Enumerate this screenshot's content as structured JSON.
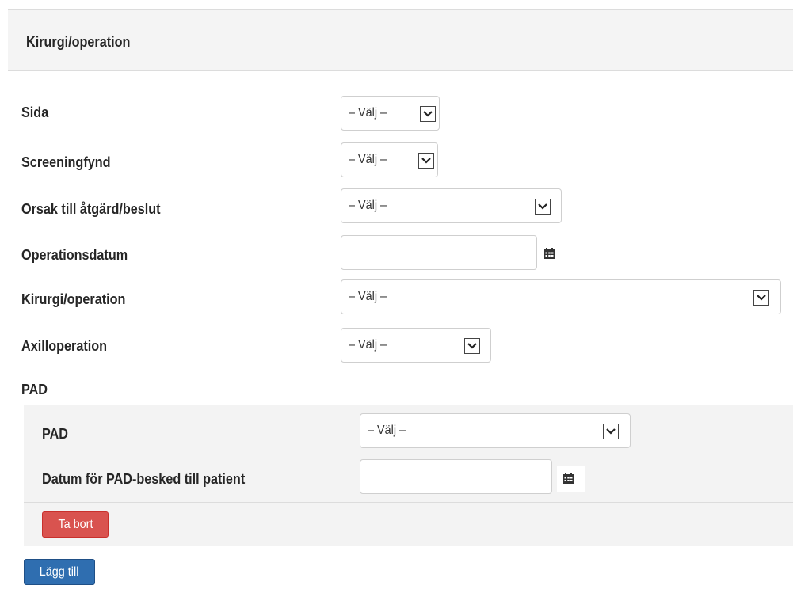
{
  "panel": {
    "title": "Kirurgi/operation"
  },
  "fields": {
    "sida": {
      "label": "Sida",
      "value": "– Välj –"
    },
    "screeningfynd": {
      "label": "Screeningfynd",
      "value": "– Välj –"
    },
    "orsak": {
      "label": "Orsak till åtgärd/beslut",
      "value": "– Välj –"
    },
    "operationsdatum": {
      "label": "Operationsdatum",
      "value": ""
    },
    "kirurgi": {
      "label": "Kirurgi/operation",
      "value": "– Välj –"
    },
    "axilloperation": {
      "label": "Axilloperation",
      "value": "– Välj –"
    }
  },
  "pad_section": {
    "title": "PAD",
    "pad": {
      "label": "PAD",
      "value": "– Välj –"
    },
    "datum": {
      "label": "Datum för PAD-besked till patient",
      "value": ""
    },
    "remove_label": "Ta bort"
  },
  "add_label": "Lägg till",
  "icons": {
    "dropdown": "chevron-down-icon",
    "calendar": "calendar-icon"
  },
  "colors": {
    "remove_button": "#d9534f",
    "add_button": "#2f6eb0"
  }
}
